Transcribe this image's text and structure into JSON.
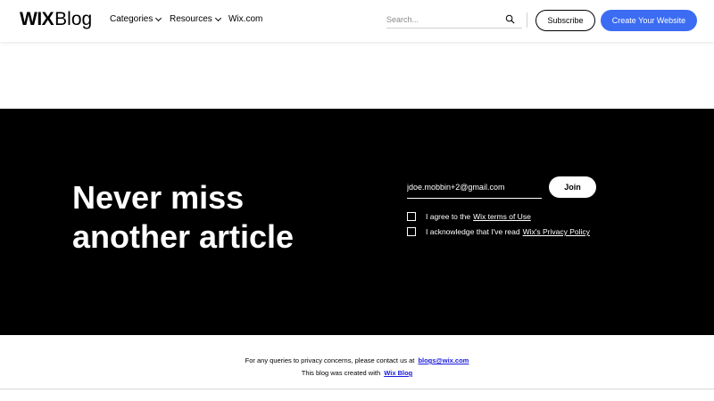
{
  "header": {
    "logo_bold": "WIX",
    "logo_light": "Blog",
    "nav": [
      {
        "label": "Categories",
        "has_dropdown": true
      },
      {
        "label": "Resources",
        "has_dropdown": true
      },
      {
        "label": "Wix.com",
        "has_dropdown": false
      }
    ],
    "search": {
      "placeholder": "Search...",
      "value": "",
      "icon": "search-icon"
    },
    "subscribe_label": "Subscribe",
    "create_label": "Create Your Website"
  },
  "newsletter": {
    "headline": "Never miss another article",
    "email_value": "jdoe.mobbin+2@gmail.com",
    "join_label": "Join",
    "consents": [
      {
        "prefix": "I agree to the",
        "link": "Wix terms of Use",
        "checked": false
      },
      {
        "prefix": "I acknowledge that I've read",
        "link": "Wix's Privacy Policy",
        "checked": false
      }
    ]
  },
  "footer": {
    "privacy_text": "For any queries to privacy concerns, please contact us at",
    "privacy_email": "blogs@wix.com",
    "created_text": "This blog was created with",
    "created_link": "Wix Blog"
  },
  "colors": {
    "accent": "#3b6cf2",
    "newsletter_bg": "#000000",
    "link_blue": "#1a1ae0"
  }
}
